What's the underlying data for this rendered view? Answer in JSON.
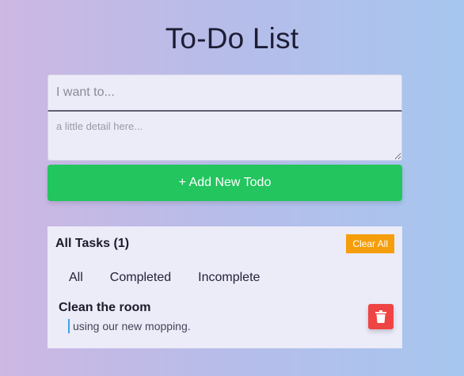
{
  "app": {
    "title": "To-Do List"
  },
  "form": {
    "title_placeholder": "I want to...",
    "detail_placeholder": "a little detail here...",
    "add_label": "+ Add New Todo"
  },
  "tasks": {
    "header": "All Tasks (1)",
    "clear_label": "Clear All",
    "filters": [
      "All",
      "Completed",
      "Incomplete"
    ],
    "items": [
      {
        "title": "Clean the room",
        "detail": "using our new mopping."
      }
    ]
  },
  "colors": {
    "add_button": "#22c55e",
    "clear_button": "#f59e0b",
    "delete_button": "#ef4444",
    "detail_accent": "#3aa5e6"
  },
  "icons": {
    "delete": "trash-icon"
  }
}
